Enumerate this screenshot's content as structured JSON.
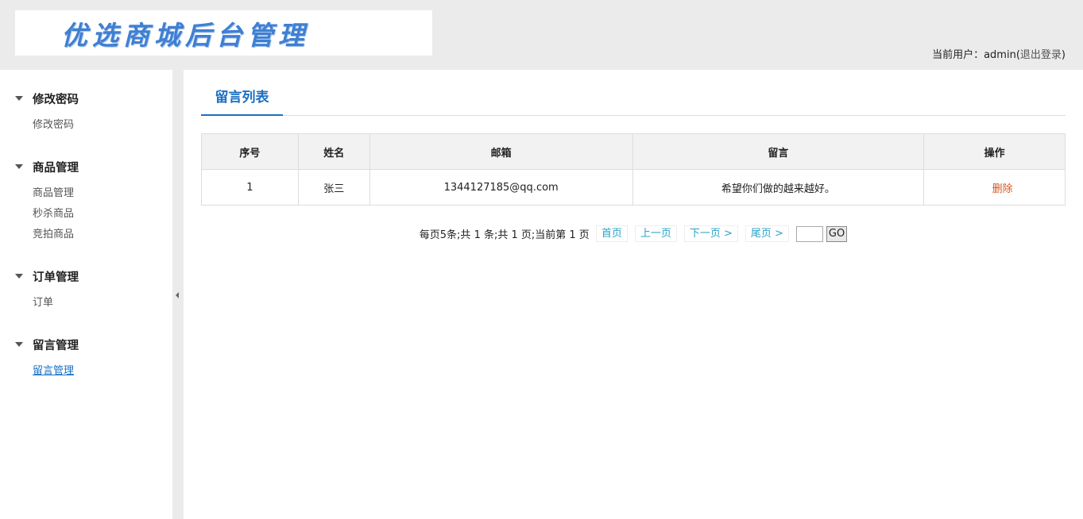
{
  "header": {
    "logo_text": "优选商城后台管理",
    "user_prefix": "当前用户：",
    "username": "admin",
    "logout_open": "(",
    "logout_label": "退出登录",
    "logout_close": ")"
  },
  "sidebar": {
    "groups": [
      {
        "title": "修改密码",
        "items": [
          {
            "label": "修改密码"
          }
        ]
      },
      {
        "title": "商品管理",
        "items": [
          {
            "label": "商品管理"
          },
          {
            "label": "秒杀商品"
          },
          {
            "label": "竞拍商品"
          }
        ]
      },
      {
        "title": "订单管理",
        "items": [
          {
            "label": "订单"
          }
        ]
      },
      {
        "title": "留言管理",
        "items": [
          {
            "label": "留言管理"
          }
        ]
      }
    ]
  },
  "main": {
    "tab_label": "留言列表",
    "table": {
      "headers": [
        "序号",
        "姓名",
        "邮箱",
        "留言",
        "操作"
      ],
      "rows": [
        {
          "id": "1",
          "name": "张三",
          "email": "1344127185@qq.com",
          "message": "希望你们做的越来越好。",
          "action": "删除"
        }
      ]
    },
    "pager": {
      "summary": "每页5条;共 1 条;共 1 页;当前第 1 页",
      "first": "首页",
      "prev": "上一页",
      "next": "下一页 >",
      "last": "尾页 >",
      "go": "GO"
    }
  }
}
